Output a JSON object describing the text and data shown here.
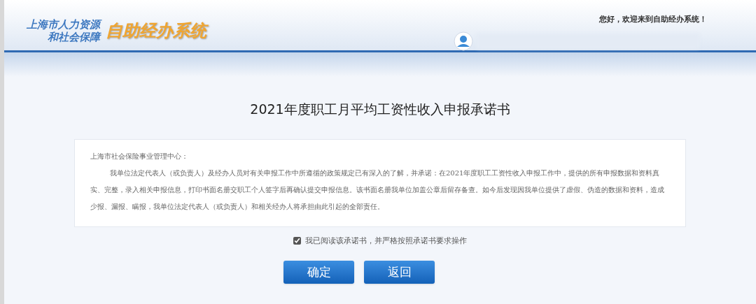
{
  "header": {
    "org_name_line_1": "上海市人力资源",
    "org_name_line_2": "和社会保障",
    "system_name": "自助经办系统",
    "welcome": "您好，欢迎来到自助经办系统！"
  },
  "title": "2021年度职工月平均工资性收入申报承诺书",
  "letter": {
    "salutation": "上海市社会保险事业管理中心：",
    "body": "我单位法定代表人（或负责人）及经办人员对有关申报工作中所遵循的政策规定已有深入的了解，并承诺：在2021年度职工工资性收入申报工作中，提供的所有申报数据和资料真实、完整，录入相关申报信息，打印书面名册交职工个人签字后再确认提交申报信息。该书面名册我单位加盖公章后留存备查。如今后发现因我单位提供了虚假、伪造的数据和资料，造成少报、漏报、瞒报，我单位法定代表人（或负责人）和相关经办人将承担由此引起的全部责任。"
  },
  "agreement": {
    "label": "我已阅读该承诺书，并严格按照承诺书要求操作",
    "checked": true
  },
  "buttons": [
    "确定",
    "返回"
  ]
}
